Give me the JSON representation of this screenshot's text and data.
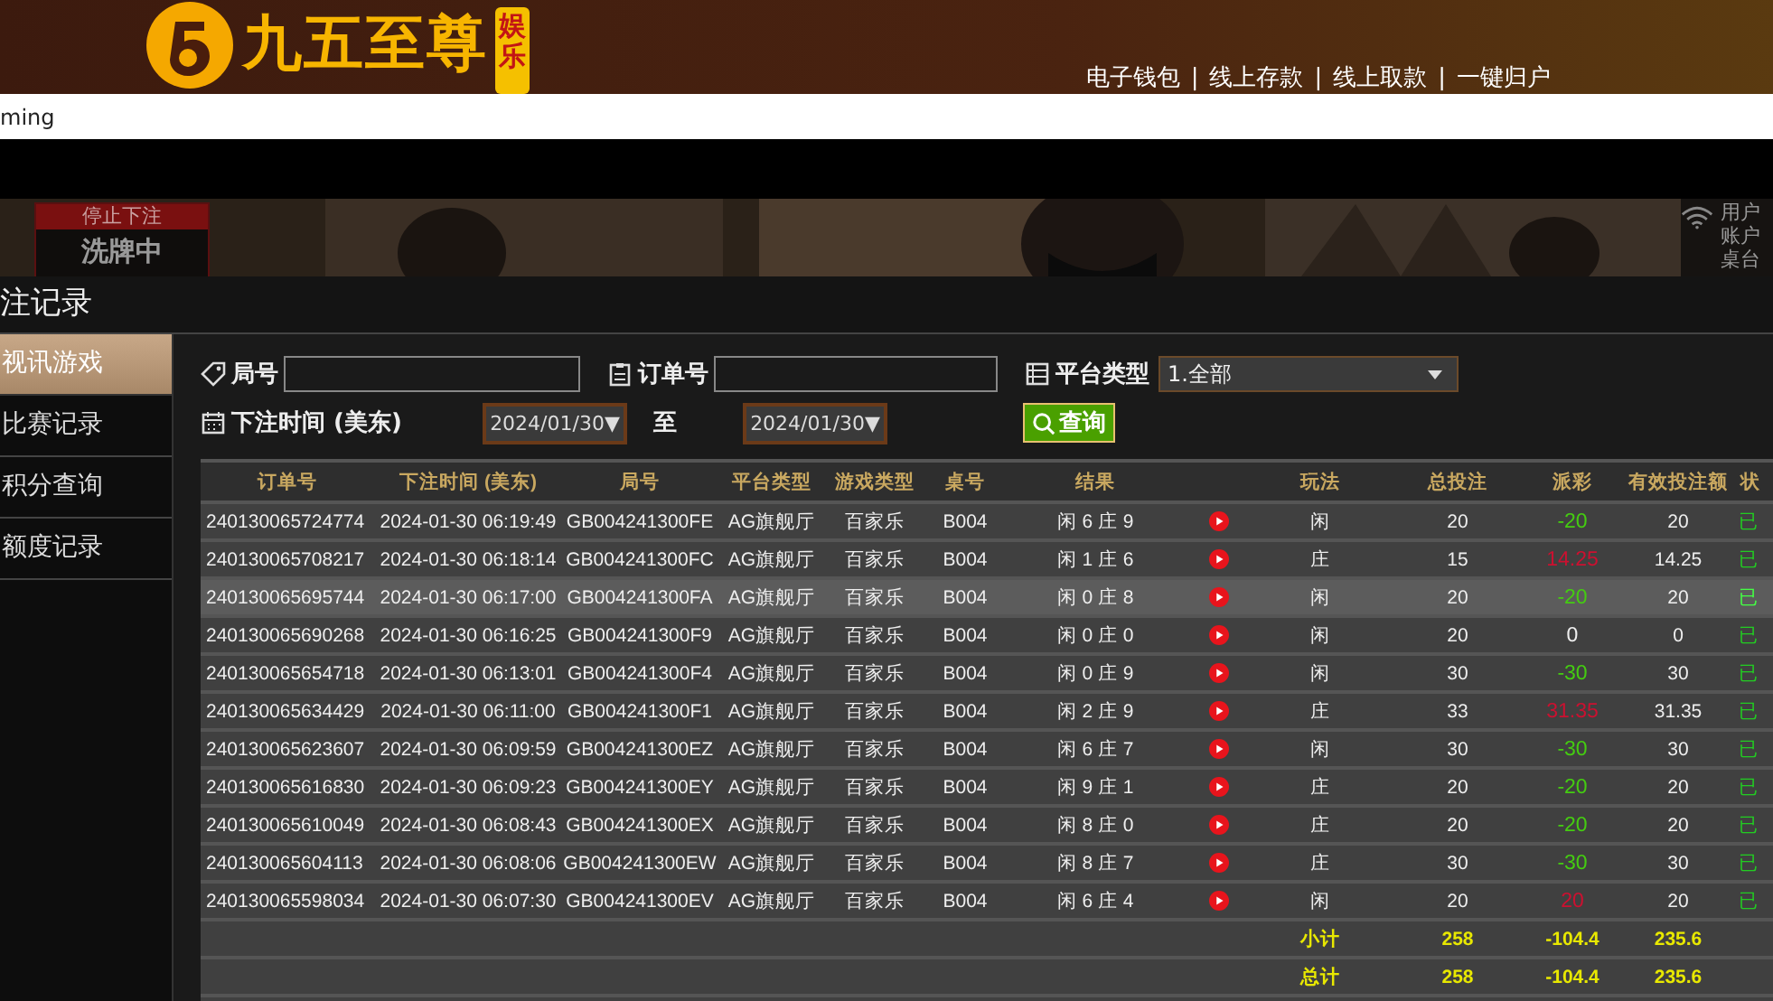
{
  "header": {
    "brand": "九五至尊",
    "brand_tag": "娱乐",
    "nav": [
      {
        "label": "电子钱包"
      },
      {
        "separator": "|",
        "label": "线上存款"
      },
      {
        "separator": "|",
        "label": "线上取款"
      },
      {
        "separator": "|",
        "label": "一键归户"
      }
    ]
  },
  "url_bar": {
    "text": "ming"
  },
  "video_strip": {
    "status": "停止下注",
    "state": "洗牌中",
    "info": [
      "用户",
      "账户",
      "桌台"
    ]
  },
  "dialog": {
    "title": "注记录"
  },
  "sidebar": {
    "items": [
      {
        "label": "视讯游戏",
        "selected": true
      },
      {
        "label": "比赛记录",
        "selected": false
      },
      {
        "label": "积分查询",
        "selected": false
      },
      {
        "label": "额度记录",
        "selected": false
      }
    ]
  },
  "filters": {
    "round_label": "局号",
    "order_label": "订单号",
    "platform_label": "平台类型",
    "platform_value": "1.全部",
    "time_label": "下注时间 (美东)",
    "date_from": "2024/01/30▼",
    "to_label": "至",
    "date_to": "2024/01/30▼",
    "query_button": "查询"
  },
  "table": {
    "columns": [
      "订单号",
      "下注时间 (美东)",
      "局号",
      "平台类型",
      "游戏类型",
      "桌号",
      "结果",
      "",
      "玩法",
      "总投注",
      "派彩",
      "有效投注额",
      "状"
    ],
    "rows": [
      {
        "order": "240130065724774",
        "time": "2024-01-30 06:19:49",
        "round": "GB004241300FE",
        "platform": "AG旗舰厅",
        "game": "百家乐",
        "table_no": "B004",
        "result": "闲 6 庄 9",
        "play": "闲",
        "bet": "20",
        "payout": {
          "text": "-20",
          "color": "#44cc11"
        },
        "valid": "20",
        "status": "已",
        "selected": false
      },
      {
        "order": "240130065708217",
        "time": "2024-01-30 06:18:14",
        "round": "GB004241300FC",
        "platform": "AG旗舰厅",
        "game": "百家乐",
        "table_no": "B004",
        "result": "闲 1 庄 6",
        "play": "庄",
        "bet": "15",
        "payout": {
          "text": "14.25",
          "color": "#cc1030"
        },
        "valid": "14.25",
        "status": "已",
        "selected": false
      },
      {
        "order": "240130065695744",
        "time": "2024-01-30 06:17:00",
        "round": "GB004241300FA",
        "platform": "AG旗舰厅",
        "game": "百家乐",
        "table_no": "B004",
        "result": "闲 0 庄 8",
        "play": "闲",
        "bet": "20",
        "payout": {
          "text": "-20",
          "color": "#44cc11"
        },
        "valid": "20",
        "status": "已",
        "selected": true
      },
      {
        "order": "240130065690268",
        "time": "2024-01-30 06:16:25",
        "round": "GB004241300F9",
        "platform": "AG旗舰厅",
        "game": "百家乐",
        "table_no": "B004",
        "result": "闲 0 庄 0",
        "play": "闲",
        "bet": "20",
        "payout": {
          "text": "0",
          "color": "#eeeeee"
        },
        "valid": "0",
        "status": "已",
        "selected": false
      },
      {
        "order": "240130065654718",
        "time": "2024-01-30 06:13:01",
        "round": "GB004241300F4",
        "platform": "AG旗舰厅",
        "game": "百家乐",
        "table_no": "B004",
        "result": "闲 0 庄 9",
        "play": "闲",
        "bet": "30",
        "payout": {
          "text": "-30",
          "color": "#44cc11"
        },
        "valid": "30",
        "status": "已",
        "selected": false
      },
      {
        "order": "240130065634429",
        "time": "2024-01-30 06:11:00",
        "round": "GB004241300F1",
        "platform": "AG旗舰厅",
        "game": "百家乐",
        "table_no": "B004",
        "result": "闲 2 庄 9",
        "play": "庄",
        "bet": "33",
        "payout": {
          "text": "31.35",
          "color": "#cc1030"
        },
        "valid": "31.35",
        "status": "已",
        "selected": false
      },
      {
        "order": "240130065623607",
        "time": "2024-01-30 06:09:59",
        "round": "GB004241300EZ",
        "platform": "AG旗舰厅",
        "game": "百家乐",
        "table_no": "B004",
        "result": "闲 6 庄 7",
        "play": "闲",
        "bet": "30",
        "payout": {
          "text": "-30",
          "color": "#44cc11"
        },
        "valid": "30",
        "status": "已",
        "selected": false
      },
      {
        "order": "240130065616830",
        "time": "2024-01-30 06:09:23",
        "round": "GB004241300EY",
        "platform": "AG旗舰厅",
        "game": "百家乐",
        "table_no": "B004",
        "result": "闲 9 庄 1",
        "play": "庄",
        "bet": "20",
        "payout": {
          "text": "-20",
          "color": "#44cc11"
        },
        "valid": "20",
        "status": "已",
        "selected": false
      },
      {
        "order": "240130065610049",
        "time": "2024-01-30 06:08:43",
        "round": "GB004241300EX",
        "platform": "AG旗舰厅",
        "game": "百家乐",
        "table_no": "B004",
        "result": "闲 8 庄 0",
        "play": "庄",
        "bet": "20",
        "payout": {
          "text": "-20",
          "color": "#44cc11"
        },
        "valid": "20",
        "status": "已",
        "selected": false
      },
      {
        "order": "240130065604113",
        "time": "2024-01-30 06:08:06",
        "round": "GB004241300EW",
        "platform": "AG旗舰厅",
        "game": "百家乐",
        "table_no": "B004",
        "result": "闲 8 庄 7",
        "play": "庄",
        "bet": "30",
        "payout": {
          "text": "-30",
          "color": "#44cc11"
        },
        "valid": "30",
        "status": "已",
        "selected": false
      },
      {
        "order": "240130065598034",
        "time": "2024-01-30 06:07:30",
        "round": "GB004241300EV",
        "platform": "AG旗舰厅",
        "game": "百家乐",
        "table_no": "B004",
        "result": "闲 6 庄 4",
        "play": "闲",
        "bet": "20",
        "payout": {
          "text": "20",
          "color": "#cc1030"
        },
        "valid": "20",
        "status": "已",
        "selected": false
      }
    ],
    "totals": [
      {
        "label": "小计",
        "bet": "258",
        "payout": "-104.4",
        "valid": "235.6"
      },
      {
        "label": "总计",
        "bet": "258",
        "payout": "-104.4",
        "valid": "235.6"
      }
    ]
  }
}
